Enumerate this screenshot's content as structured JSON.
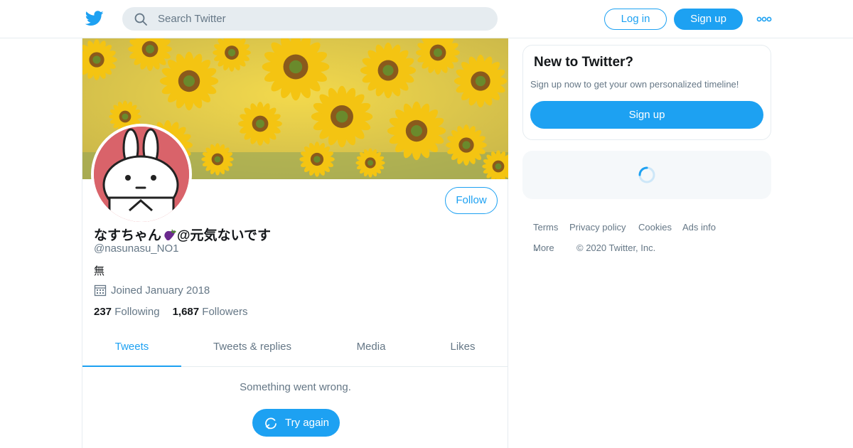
{
  "header": {
    "logo_icon": "twitter-bird-icon",
    "search_placeholder": "Search Twitter",
    "login_label": "Log in",
    "signup_label": "Sign up",
    "more_icon": "more-dots-icon",
    "brand_color": "#1da1f2"
  },
  "profile": {
    "display_name": "なすちゃん",
    "display_name_suffix": "@元気ないです",
    "name_emoji": "eggplant-emoji",
    "handle": "@nasunasu_NO1",
    "bio": "無",
    "joined": "Joined January 2018",
    "following_count": "237",
    "following_label": "Following",
    "followers_count": "1,687",
    "followers_label": "Followers",
    "follow_label": "Follow"
  },
  "tabs": [
    {
      "label": "Tweets",
      "active": true
    },
    {
      "label": "Tweets & replies",
      "active": false
    },
    {
      "label": "Media",
      "active": false
    },
    {
      "label": "Likes",
      "active": false
    }
  ],
  "timeline": {
    "error_message": "Something went wrong.",
    "retry_label": "Try again"
  },
  "sidebar": {
    "new_title": "New to Twitter?",
    "new_subtitle": "Sign up now to get your own personalized timeline!",
    "signup_label": "Sign up"
  },
  "footer": {
    "links": [
      "Terms",
      "Privacy policy",
      "Cookies",
      "Ads info"
    ],
    "more_label": "More",
    "copyright": "© 2020 Twitter, Inc."
  }
}
